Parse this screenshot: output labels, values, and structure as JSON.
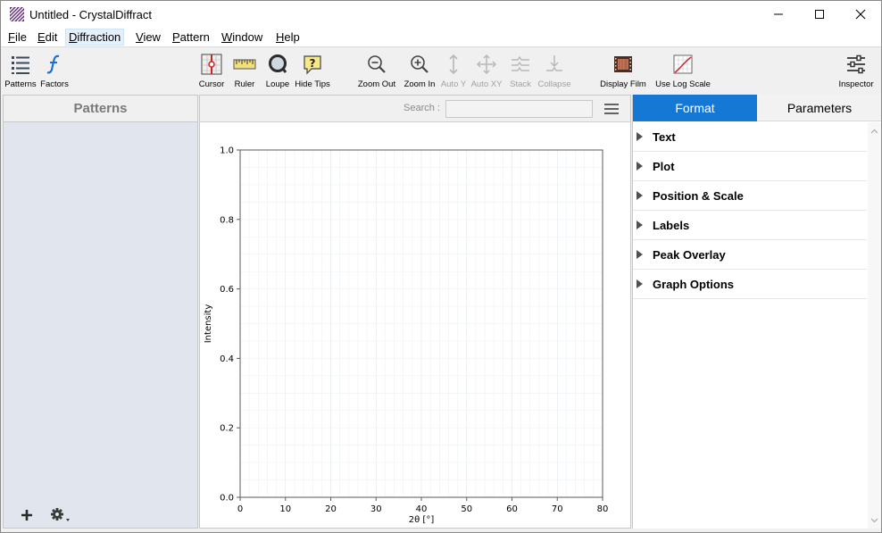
{
  "window": {
    "title": "Untitled - CrystalDiffract",
    "app_icon": "crystal-app-icon",
    "controls": [
      "minimize-icon",
      "maximize-icon",
      "close-icon"
    ]
  },
  "menu": {
    "items": [
      {
        "label": "File",
        "active": false
      },
      {
        "label": "Edit",
        "active": false
      },
      {
        "label": "Diffraction",
        "active": true
      },
      {
        "label": "View",
        "active": false
      },
      {
        "label": "Pattern",
        "active": false
      },
      {
        "label": "Window",
        "active": false
      },
      {
        "label": "Help",
        "active": false
      }
    ]
  },
  "toolbar": {
    "patterns": {
      "label": "Patterns",
      "icon": "list-icon",
      "enabled": true
    },
    "factors": {
      "label": "Factors",
      "icon": "function-icon",
      "enabled": true
    },
    "cursor": {
      "label": "Cursor",
      "icon": "cursor-icon",
      "enabled": true
    },
    "ruler": {
      "label": "Ruler",
      "icon": "ruler-icon",
      "enabled": true
    },
    "loupe": {
      "label": "Loupe",
      "icon": "loupe-icon",
      "enabled": true
    },
    "hide_tips": {
      "label": "Hide Tips",
      "icon": "tips-icon",
      "enabled": true
    },
    "zoom_out": {
      "label": "Zoom Out",
      "icon": "zoom-out-icon",
      "enabled": true
    },
    "zoom_in": {
      "label": "Zoom In",
      "icon": "zoom-in-icon",
      "enabled": true
    },
    "auto_y": {
      "label": "Auto  Y",
      "icon": "auto-y-icon",
      "enabled": false
    },
    "auto_xy": {
      "label": "Auto XY",
      "icon": "auto-xy-icon",
      "enabled": false
    },
    "stack": {
      "label": "Stack",
      "icon": "stack-icon",
      "enabled": false
    },
    "collapse": {
      "label": "Collapse",
      "icon": "collapse-icon",
      "enabled": false
    },
    "display_film": {
      "label": "Display Film",
      "icon": "film-icon",
      "enabled": true
    },
    "log_scale": {
      "label": "Use Log Scale",
      "icon": "log-scale-icon",
      "enabled": true
    },
    "inspector": {
      "label": "Inspector",
      "icon": "sliders-icon",
      "enabled": true
    }
  },
  "patterns_panel": {
    "title": "Patterns",
    "add_icon": "plus-icon",
    "settings_icon": "gear-icon"
  },
  "search": {
    "label": "Search :",
    "value": "",
    "placeholder": ""
  },
  "chart_data": {
    "type": "line",
    "title": "",
    "xlabel": "2θ [°]",
    "ylabel": "Intensity",
    "xlim": [
      0,
      80
    ],
    "ylim": [
      0.0,
      1.0
    ],
    "x_ticks": [
      "0",
      "10",
      "20",
      "30",
      "40",
      "50",
      "60",
      "70",
      "80"
    ],
    "y_ticks": [
      "0.0",
      "0.2",
      "0.4",
      "0.6",
      "0.8",
      "1.0"
    ],
    "grid": true,
    "series": []
  },
  "inspector": {
    "tabs": [
      {
        "label": "Format",
        "selected": true
      },
      {
        "label": "Parameters",
        "selected": false
      }
    ],
    "sections": [
      "Text",
      "Plot",
      "Position & Scale",
      "Labels",
      "Peak Overlay",
      "Graph Options"
    ]
  },
  "colors": {
    "accent": "#1478d4",
    "panel_bg": "#e1e6ee",
    "grid_minor": "#ecf0f8",
    "grid_major": "#dfe5f1"
  }
}
